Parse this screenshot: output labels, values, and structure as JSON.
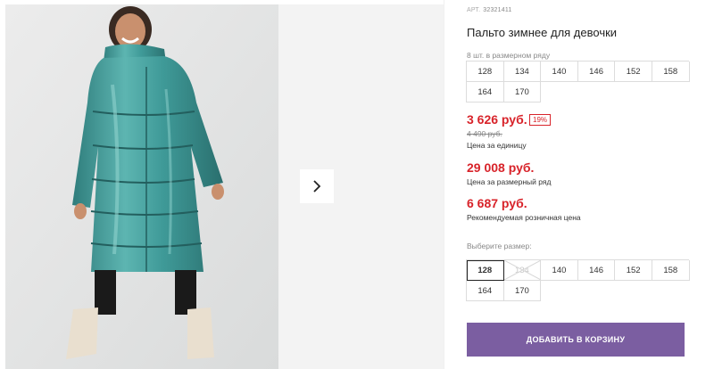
{
  "product": {
    "article_label": "АРТ.",
    "article": "32321411",
    "title": "Пальто зимнее для девочки",
    "pack_note": "8 шт. в размерном ряду"
  },
  "size_row": [
    "128",
    "134",
    "140",
    "146",
    "152",
    "158",
    "164",
    "170"
  ],
  "pricing": {
    "unit_price": "3 626 руб.",
    "discount": "19%",
    "old_price": "4 490 руб.",
    "unit_label": "Цена за единицу",
    "row_price": "29 008 руб.",
    "row_label": "Цена за размерный ряд",
    "rrp_price": "6 687 руб.",
    "rrp_label": "Рекомендуемая розничная цена"
  },
  "size_picker": {
    "label": "Выберите размер:",
    "options": [
      {
        "label": "128",
        "state": "selected"
      },
      {
        "label": "134",
        "state": "unavailable"
      },
      {
        "label": "140",
        "state": "available"
      },
      {
        "label": "146",
        "state": "available"
      },
      {
        "label": "152",
        "state": "available"
      },
      {
        "label": "158",
        "state": "available"
      },
      {
        "label": "164",
        "state": "available"
      },
      {
        "label": "170",
        "state": "available"
      }
    ]
  },
  "cart_button": "Добавить в корзину",
  "colors": {
    "price_red": "#d8232a",
    "button_purple": "#7b5ea1",
    "coat_teal": "#3f9a98"
  },
  "gallery": {
    "image_subject": "product-photo-girl-teal-winter-coat",
    "next_icon": "chevron-right-icon"
  }
}
